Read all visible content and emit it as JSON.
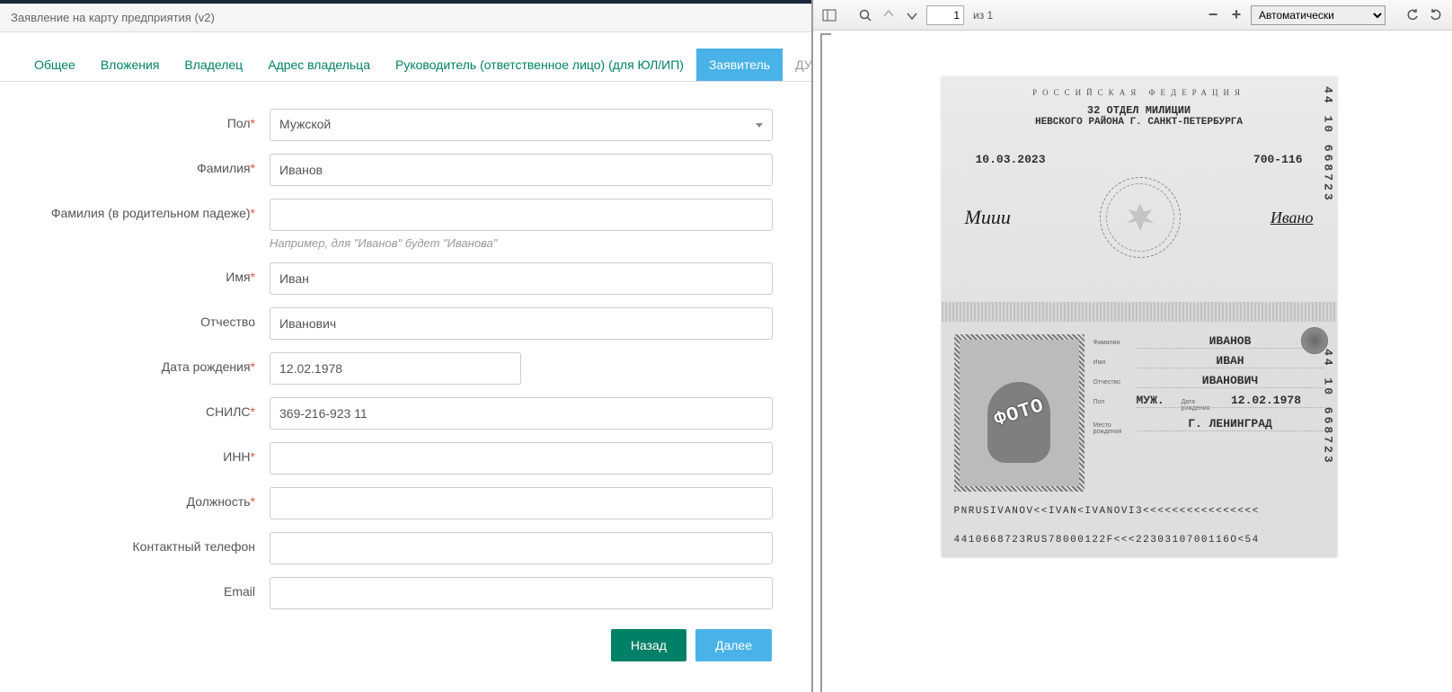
{
  "title": "Заявление на карту предприятия (v2)",
  "tabs": {
    "general": "Общее",
    "attachments": "Вложения",
    "owner": "Владелец",
    "owner_addr": "Адрес владельца",
    "manager": "Руководитель (ответственное лицо) (для ЮЛ/ИП)",
    "applicant": "Заявитель",
    "applicant_dul": "ДУЛ заявителя"
  },
  "form": {
    "gender": {
      "label": "Пол",
      "value": "Мужской"
    },
    "lastname": {
      "label": "Фамилия",
      "value": "Иванов"
    },
    "lastname_gen": {
      "label": "Фамилия (в родительном падеже)",
      "value": "",
      "hint": "Например, для \"Иванов\" будет \"Иванова\""
    },
    "firstname": {
      "label": "Имя",
      "value": "Иван"
    },
    "patronymic": {
      "label": "Отчество",
      "value": "Иванович"
    },
    "birthdate": {
      "label": "Дата рождения",
      "value": "12.02.1978"
    },
    "snils": {
      "label": "СНИЛС",
      "value": "369-216-923 11"
    },
    "inn": {
      "label": "ИНН",
      "value": ""
    },
    "position": {
      "label": "Должность",
      "value": ""
    },
    "phone": {
      "label": "Контактный телефон",
      "value": ""
    },
    "email": {
      "label": "Email",
      "value": ""
    }
  },
  "buttons": {
    "back": "Назад",
    "next": "Далее"
  },
  "pdf": {
    "page": "1",
    "pages_of": "из 1",
    "zoom": "Автоматически"
  },
  "passport": {
    "rf": "РОССИЙСКАЯ ФЕДЕРАЦИЯ",
    "dept1": "32 ОТДЕЛ МИЛИЦИИ",
    "dept2": "НЕВСКОГО РАЙОНА Г. САНКТ-ПЕТЕРБУРГА",
    "issue_date": "10.03.2023",
    "code": "700-116",
    "sign_left": "Миии",
    "sign_right": "Ивано",
    "serial_top": "44 10 668723",
    "serial_bot": "44 10 668723",
    "photo_overlay": "ФОТО",
    "f_lastname_l": "Фамилия",
    "f_lastname": "ИВАНОВ",
    "f_firstname_l": "Имя",
    "f_firstname": "ИВАН",
    "f_patr_l": "Отчество",
    "f_patr": "ИВАНОВИЧ",
    "f_sex_l": "Пол",
    "f_sex": "МУЖ.",
    "f_dob_l": "Дата рождения",
    "f_dob": "12.02.1978",
    "f_place_l": "Место рождения",
    "f_place": "Г. ЛЕНИНГРАД",
    "mrz1": "PNRUSIVANOV<<IVAN<IVANOVI3<<<<<<<<<<<<<<<<",
    "mrz2": "4410668723RUS78000122F<<<2230310700116O<54"
  }
}
